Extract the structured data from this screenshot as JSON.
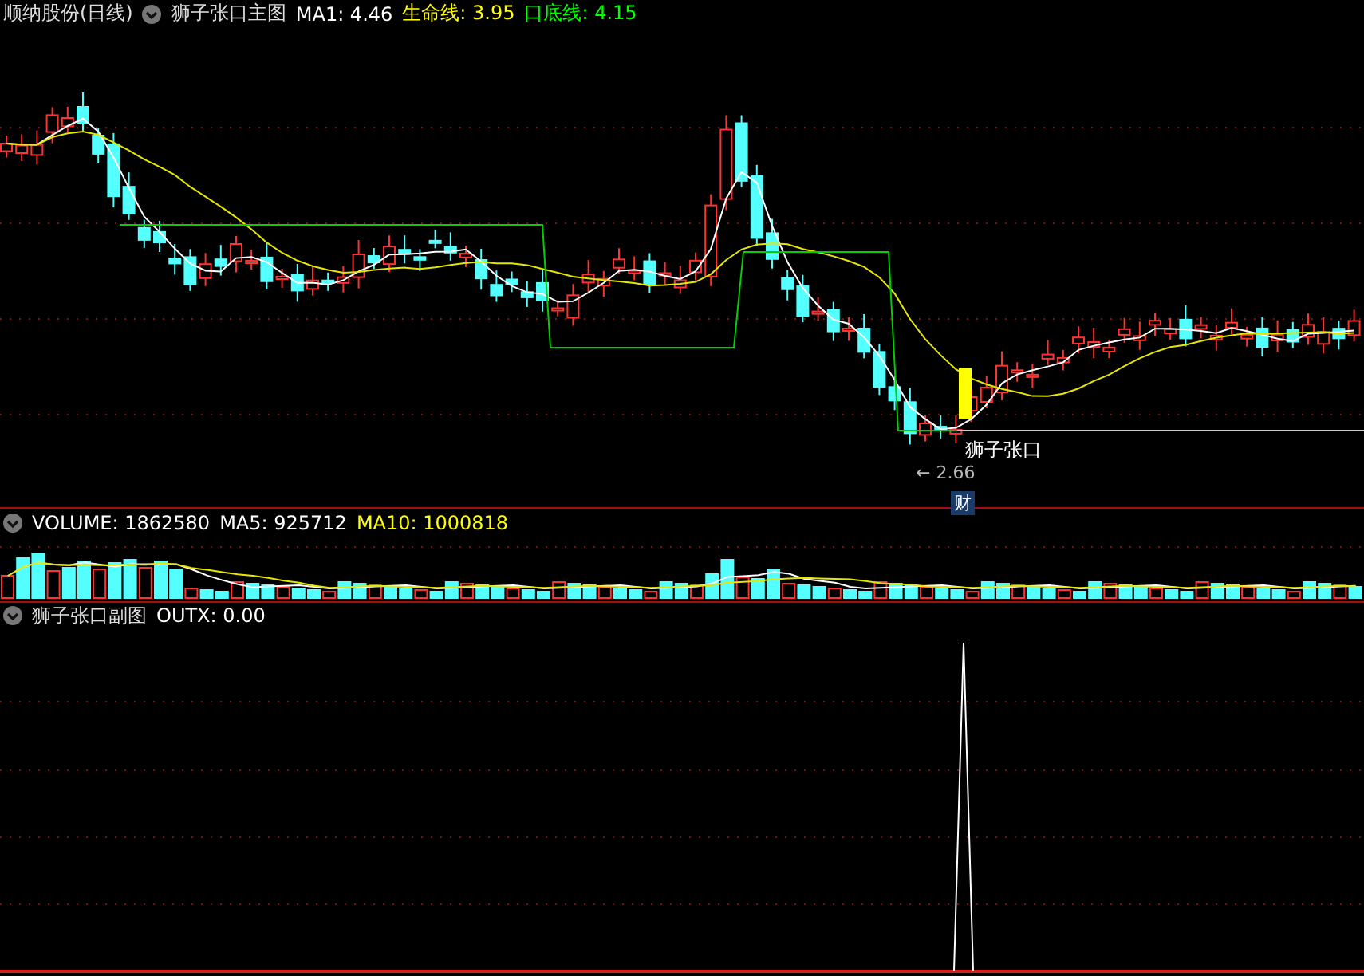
{
  "main_panel": {
    "stock_title": "顺纳股份(日线)",
    "indicator": "狮子张口主图",
    "readings": [
      {
        "text": "MA1: 4.46",
        "color": "#ffffff"
      },
      {
        "text": "生命线: 3.95",
        "color": "#ffff00"
      },
      {
        "text": "口底线: 4.15",
        "color": "#00ff00"
      }
    ],
    "signal_label": "狮子张口",
    "low_label": "← 2.66",
    "badge": "财"
  },
  "volume_panel": {
    "readings": [
      {
        "text": "VOLUME: 1862580",
        "color": "#ffffff"
      },
      {
        "text": "MA5: 925712",
        "color": "#ffffff"
      },
      {
        "text": "MA10: 1000818",
        "color": "#ffff00"
      }
    ]
  },
  "sub_panel": {
    "indicator": "狮子张口副图",
    "readings": [
      {
        "text": "OUTX: 0.00",
        "color": "#ffffff"
      }
    ]
  }
}
